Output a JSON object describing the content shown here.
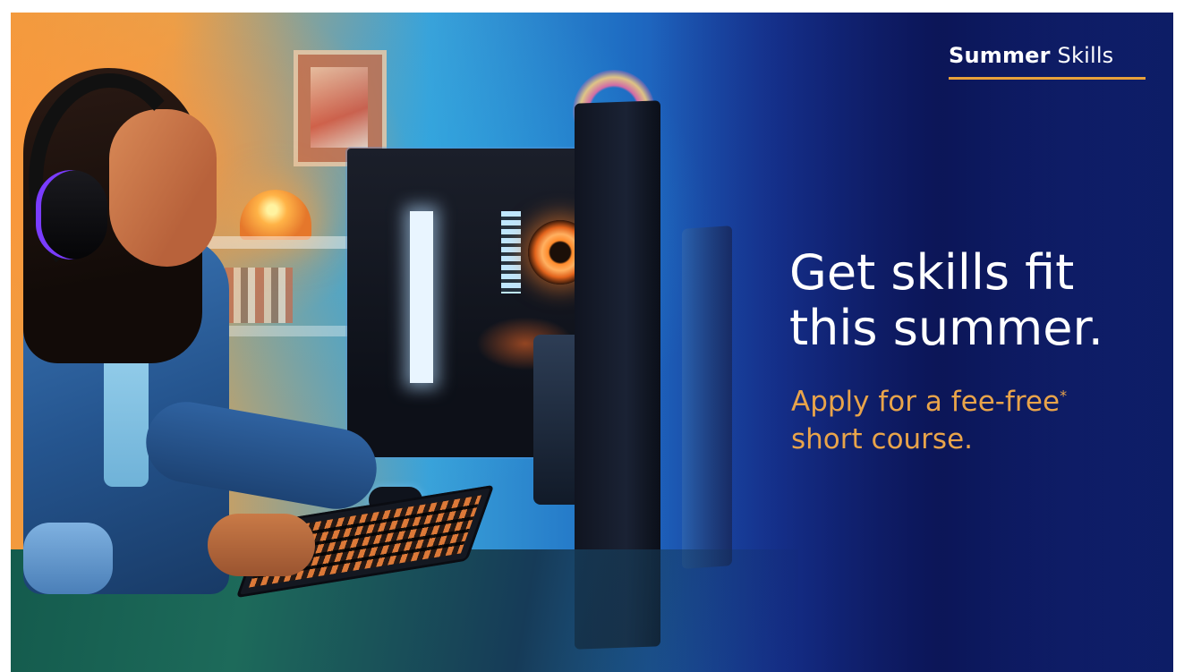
{
  "brand": {
    "word1": "Summer",
    "word2": "Skills",
    "underline_color": "#e8a13a"
  },
  "headline": {
    "line1": "Get skills fit",
    "line2": "this summer."
  },
  "subheadline": {
    "line1": "Apply for a fee-free",
    "asterisk": "*",
    "line2": "short course."
  },
  "colors": {
    "headline": "#ffffff",
    "subheadline": "#e9a44a",
    "background_right": "#0d1d66",
    "background_left": "#f39a3d"
  }
}
